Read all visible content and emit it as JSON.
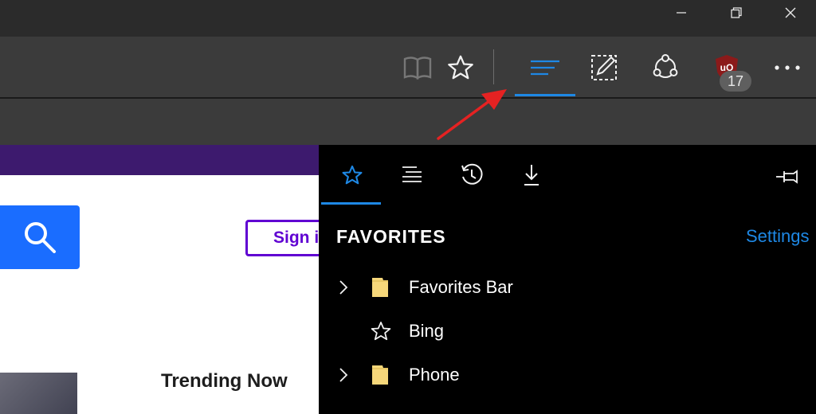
{
  "window_controls": {
    "minimize_icon": "minimize-icon",
    "restore_icon": "restore-icon",
    "close_icon": "close-icon"
  },
  "toolbar": {
    "reading_view_icon": "book-icon",
    "favorite_icon": "star-icon",
    "hub_icon": "hub-lines-icon",
    "web_note_icon": "pen-square-icon",
    "share_icon": "share-icon",
    "extension": {
      "icon": "ublock-shield-icon",
      "badge_count": "17"
    },
    "more_icon": "ellipsis-icon",
    "accent": "#1e88e5"
  },
  "webpage": {
    "signin_label": "Sign i",
    "trending_label": "Trending Now",
    "search_icon": "search-icon",
    "brand_purple": "#6001d2",
    "search_blue": "#1a6dff"
  },
  "hub_panel": {
    "tabs": [
      {
        "name": "favorites",
        "icon": "star-icon"
      },
      {
        "name": "reading-list",
        "icon": "reading-list-icon"
      },
      {
        "name": "history",
        "icon": "history-icon"
      },
      {
        "name": "downloads",
        "icon": "download-icon"
      }
    ],
    "pin_icon": "pin-icon",
    "title": "FAVORITES",
    "settings_label": "Settings",
    "items": [
      {
        "label": "Favorites Bar",
        "type": "folder",
        "expandable": true
      },
      {
        "label": "Bing",
        "type": "favorite",
        "expandable": false
      },
      {
        "label": "Phone",
        "type": "folder",
        "expandable": true
      }
    ],
    "folder_color": "#f6d77a"
  },
  "annotation": {
    "arrow_color": "#e52222"
  }
}
